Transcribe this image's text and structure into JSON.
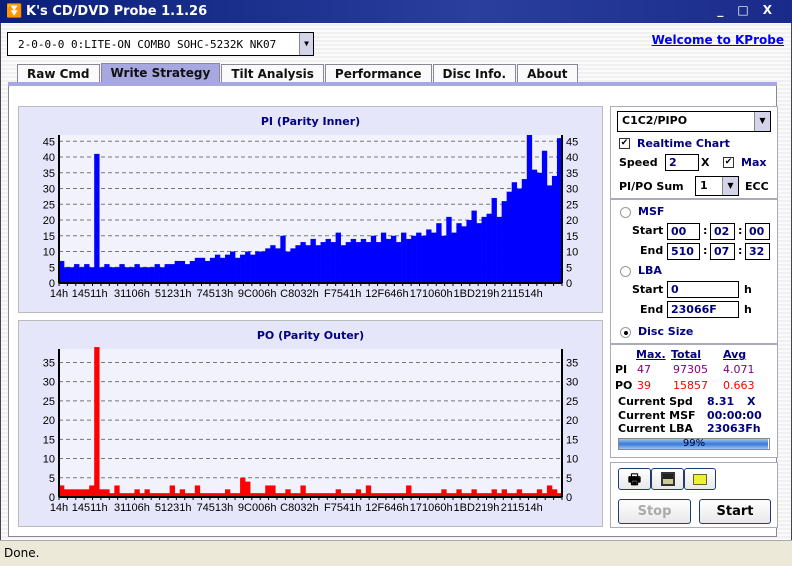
{
  "window": {
    "title": "K's CD/DVD Probe 1.1.26",
    "controls": [
      "_",
      "□",
      "X"
    ]
  },
  "drive": {
    "selected": "2-0-0-0 0:LITE-ON COMBO SOHC-5232K NK07"
  },
  "welcome_link": "Welcome to KProbe",
  "tabs": [
    {
      "label": "Raw Cmd"
    },
    {
      "label": "Write Strategy",
      "active": true
    },
    {
      "label": "Tilt Analysis"
    },
    {
      "label": "Performance"
    },
    {
      "label": "Disc Info."
    },
    {
      "label": "About"
    }
  ],
  "controls": {
    "mode": "C1C2/PIPO",
    "realtime_label": "Realtime Chart",
    "realtime_checked": true,
    "speed_label": "Speed",
    "speed_value": "2",
    "speed_unit": "X",
    "max_label": "Max",
    "max_checked": true,
    "sum_label": "PI/PO Sum",
    "sum_value": "1",
    "ecc_label": "ECC",
    "msf_label": "MSF",
    "start_label": "Start",
    "end_label": "End",
    "msf_start": [
      "00",
      "02",
      "00"
    ],
    "msf_end": [
      "510",
      "07",
      "32"
    ],
    "lba_label": "LBA",
    "lba_start": "0",
    "lba_end": "23066F",
    "h": "h",
    "disc_size_label": "Disc Size",
    "selected_range": "Disc Size"
  },
  "stats": {
    "headers": [
      "Max.",
      "Total",
      "Avg"
    ],
    "pi": {
      "label": "PI",
      "max": "47",
      "total": "97305",
      "avg": "4.071"
    },
    "po": {
      "label": "PO",
      "max": "39",
      "total": "15857",
      "avg": "0.663"
    },
    "current_spd_label": "Current Spd",
    "current_spd": "8.31",
    "current_spd_unit": "X",
    "current_msf_label": "Current MSF",
    "current_msf": "00:00:00",
    "current_lba_label": "Current LBA",
    "current_lba": "23063Fh",
    "progress_text": "99%",
    "progress": 0.99
  },
  "buttons": {
    "stop": "Stop",
    "start": "Start",
    "print_icon": "printer-icon",
    "save_icon": "floppy-disk-icon",
    "open_icon": "folder-icon"
  },
  "status": "Done.",
  "colors": {
    "pi": "#0000ff",
    "po": "#ff0000",
    "panel": "#e6e6fa",
    "title": "#000080"
  },
  "chart_data": [
    {
      "type": "bar",
      "title": "PI (Parity Inner)",
      "ylim": [
        0,
        47
      ],
      "yticks": [
        0,
        5,
        10,
        15,
        20,
        25,
        30,
        35,
        40,
        45
      ],
      "grid": true,
      "color": "#0000ff",
      "categories": [
        "14h",
        "14511h",
        "31106h",
        "51231h",
        "74513h",
        "9C006h",
        "C8032h",
        "F7541h",
        "12F646h",
        "171060h",
        "1BD219h",
        "211514h"
      ],
      "values": [
        7,
        5,
        5,
        6,
        5,
        6,
        5,
        41,
        5,
        6,
        5,
        5,
        6,
        5,
        5,
        6,
        5,
        5,
        5,
        6,
        5,
        6,
        6,
        7,
        7,
        6,
        7,
        8,
        8,
        7,
        8,
        9,
        8,
        9,
        10,
        8,
        9,
        10,
        9,
        10,
        10,
        11,
        12,
        11,
        15,
        10,
        11,
        12,
        13,
        12,
        14,
        12,
        13,
        14,
        13,
        16,
        12,
        13,
        14,
        13,
        14,
        13,
        15,
        13,
        16,
        14,
        15,
        13,
        16,
        14,
        15,
        16,
        15,
        17,
        16,
        19,
        15,
        21,
        16,
        19,
        18,
        20,
        23,
        19,
        21,
        22,
        27,
        21,
        26,
        29,
        32,
        30,
        33,
        47,
        36,
        35,
        42,
        31,
        34,
        46
      ]
    },
    {
      "type": "bar",
      "title": "PO (Parity Outer)",
      "ylim": [
        0,
        38.5
      ],
      "yticks": [
        0,
        5,
        10,
        15,
        20,
        25,
        30,
        35
      ],
      "grid": true,
      "color": "#ff0000",
      "categories": [
        "14h",
        "14511h",
        "31106h",
        "51231h",
        "74513h",
        "9C006h",
        "C8032h",
        "F7541h",
        "12F646h",
        "171060h",
        "1BD219h",
        "211514h"
      ],
      "values": [
        3,
        2,
        2,
        2,
        2,
        2,
        3,
        39,
        2,
        2,
        1,
        3,
        1,
        1,
        1,
        2,
        1,
        2,
        1,
        1,
        1,
        1,
        3,
        1,
        2,
        1,
        1,
        3,
        1,
        1,
        1,
        1,
        1,
        2,
        1,
        1,
        5,
        4,
        1,
        1,
        1,
        3,
        3,
        1,
        1,
        2,
        1,
        1,
        3,
        1,
        1,
        1,
        1,
        1,
        1,
        2,
        1,
        1,
        1,
        2,
        1,
        3,
        1,
        1,
        1,
        1,
        1,
        1,
        1,
        3,
        1,
        1,
        1,
        1,
        1,
        1,
        2,
        1,
        1,
        2,
        1,
        1,
        2,
        1,
        1,
        1,
        2,
        1,
        2,
        1,
        1,
        2,
        1,
        1,
        1,
        2,
        1,
        3,
        2,
        1
      ]
    }
  ]
}
